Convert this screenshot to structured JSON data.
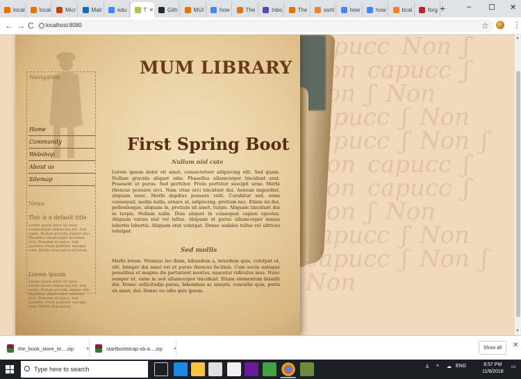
{
  "browser": {
    "tabs": [
      {
        "label": "local",
        "color": "#e37400"
      },
      {
        "label": "local",
        "color": "#e37400"
      },
      {
        "label": "Micr",
        "color": "#d83b01"
      },
      {
        "label": "Mail",
        "color": "#0f6cbd"
      },
      {
        "label": "edu",
        "color": "#4285f4"
      },
      {
        "label": "T",
        "color": "#b0c44a"
      },
      {
        "label": "Gith",
        "color": "#24292e"
      },
      {
        "label": "MUI",
        "color": "#e37400"
      },
      {
        "label": "how",
        "color": "#4285f4"
      },
      {
        "label": "The",
        "color": "#e37400"
      },
      {
        "label": "Inbo",
        "color": "#5a4ab0"
      },
      {
        "label": "The",
        "color": "#e37400"
      },
      {
        "label": "sorti",
        "color": "#f48024"
      },
      {
        "label": "how",
        "color": "#4285f4"
      },
      {
        "label": "how",
        "color": "#4285f4"
      },
      {
        "label": "bcal",
        "color": "#f48024"
      },
      {
        "label": "forg",
        "color": "#c5221f"
      }
    ],
    "new_tab": "+",
    "window_controls": [
      "–",
      "☐",
      "✕"
    ],
    "nav": {
      "back": "←",
      "forward": "→",
      "reload": "C"
    },
    "address": "localhost:8080",
    "star": "☆",
    "menu": "⋮"
  },
  "page": {
    "site_title": "MUM LIBRARY",
    "nav": {
      "heading": "Navigation",
      "links": [
        "Home",
        "Community",
        "Webshop",
        "About us",
        "Sitemap"
      ]
    },
    "news": {
      "heading": "News",
      "subheading": "This is a default title",
      "body": "Lorem ipsum dolor sit amet consectetuer adipiscing elit. Sed quam. Nullam gravida aliquet odio. Phasellus ullamcorper tincidunt erat. Praesent ut purus. Sed porttitor. Proin porttitor suscipit urna. Morbi vitae purus ut lorem.",
      "subheading2": "Lorem ipsum",
      "body2": "Lorem ipsum dolor sit amet consectetuer adipiscing elit. Sed quam. Nullam gravida aliquet odio. Phasellus ullamcorper tincidunt erat. Praesent ut purus. Sed porttitor. Proin porttitor suscipit urna. Morbi vitae purus."
    },
    "content": {
      "title": "First Spring Boot",
      "subtitle": "Nullam nisl cute",
      "paragraph1": "Lorem ipsum dolor sit amet, consectetuer adipiscing elit. Sed quam. Nullam gravida aliquet odio. Phasellus ullamcorper tincidunt erat. Praesent ut purus. Sed porttitor. Proin porttitor suscipit urna. Morbi rhoncus posuere orci. Nam vitae orci tincidunt dui. Aenean imperdiet, aliquam nunc. Morbi dapibus posuere velit. Curabitur sed, enim consequat, mollis nulla, ornare at, adipiscing, pretium nec. Etiam mi dui, pellentesque, aliquam in, pretium sit amet, turpis. Aliquam tincidunt dui in turpis. Nullam nulla. Duis aliquet in consequat sapien egestas. Aliquam varius nisl vel tellus. Aliquam at purus ullamcorper massa lobortis lobortis. Aliquam erat volutpat. Donec sodales tellus vel ultrices volutpat.",
      "heading2": "Sed mollis",
      "paragraph2": "Morbi lorem. Vivamus leo diam, bibendum a, interdum quis, volutpat ut, elit. Integer dui amet est ut purus rhoncus facilisis. Cum sociis natoque penatibus et magnis dis parturient montes, nascetur ridiculus mus. Nunc semper ut, enim in sed ullamcorper tincidunt. Etiam elementum blandit dui. Donec sollicitudin purus, bibendum ac mauris, convallis quis, porta sit amet, dui. Donec eu odio quis ipsum."
    },
    "background_script": "capucc Non ʃ Non capucc ʃ Non ʃ Non capucc ʃ Non capucc ʃ Non ʃ Non capucc ʃ Non capucc ʃ Non ʃ Non capucc ʃ Non capucc ʃ Non ʃ Non"
  },
  "downloads": {
    "items": [
      "the_book_store_te....zip",
      "startbootstrap-sb-a....zip"
    ],
    "show_all": "Show all",
    "close": "✕"
  },
  "taskbar": {
    "search_placeholder": "Type here to search",
    "tray_text": "ENG",
    "time": "8:57 PM",
    "date": "11/6/2018"
  }
}
